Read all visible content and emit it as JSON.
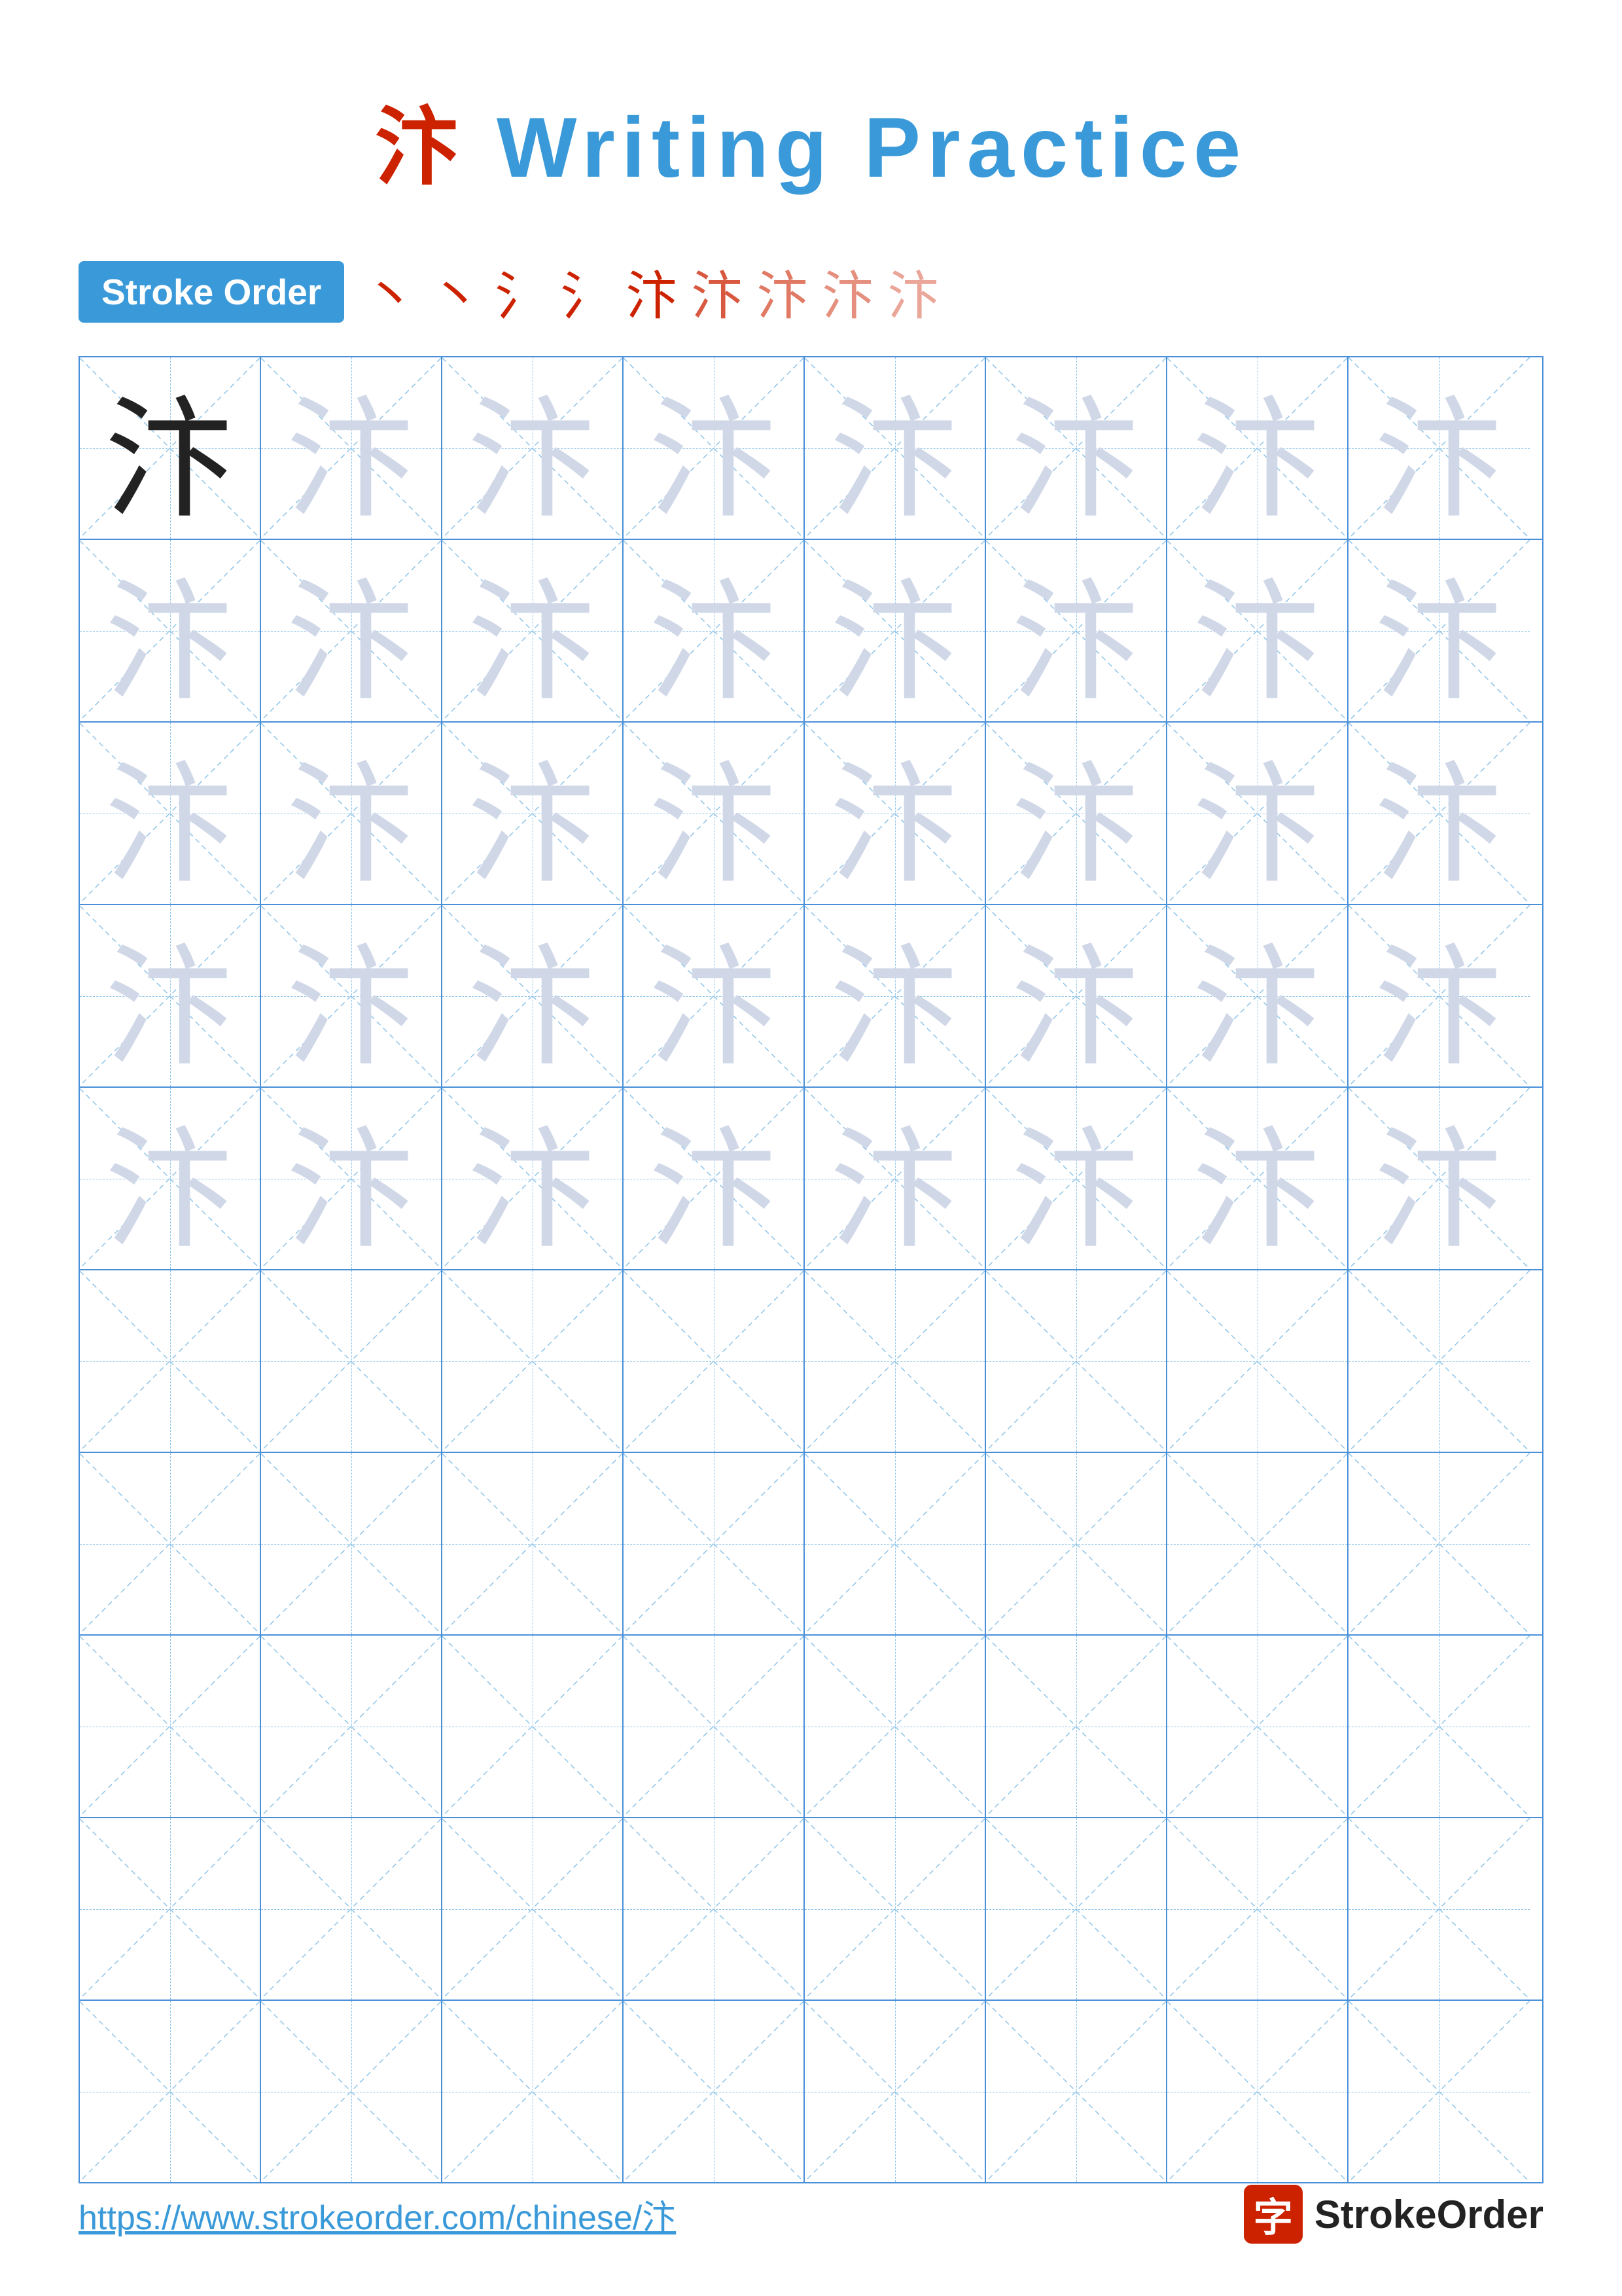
{
  "title": "汴 Writing Practice",
  "title_char": "汴",
  "title_suffix": " Writing Practice",
  "stroke_order": {
    "label": "Stroke Order",
    "chars": [
      "丶",
      "丶",
      "氵",
      "氵",
      "汴",
      "汴",
      "汴",
      "汴",
      "汴"
    ]
  },
  "practice_char": "汴",
  "rows": [
    {
      "type": "mixed",
      "cells": [
        "dark",
        "light",
        "light",
        "light",
        "light",
        "light",
        "light",
        "light"
      ]
    },
    {
      "type": "light",
      "cells": [
        "light",
        "light",
        "light",
        "light",
        "light",
        "light",
        "light",
        "light"
      ]
    },
    {
      "type": "light",
      "cells": [
        "light",
        "light",
        "light",
        "light",
        "light",
        "light",
        "light",
        "light"
      ]
    },
    {
      "type": "light",
      "cells": [
        "light",
        "light",
        "light",
        "light",
        "light",
        "light",
        "light",
        "light"
      ]
    },
    {
      "type": "light",
      "cells": [
        "light",
        "light",
        "light",
        "light",
        "light",
        "light",
        "light",
        "light"
      ]
    },
    {
      "type": "empty",
      "cells": [
        "empty",
        "empty",
        "empty",
        "empty",
        "empty",
        "empty",
        "empty",
        "empty"
      ]
    },
    {
      "type": "empty",
      "cells": [
        "empty",
        "empty",
        "empty",
        "empty",
        "empty",
        "empty",
        "empty",
        "empty"
      ]
    },
    {
      "type": "empty",
      "cells": [
        "empty",
        "empty",
        "empty",
        "empty",
        "empty",
        "empty",
        "empty",
        "empty"
      ]
    },
    {
      "type": "empty",
      "cells": [
        "empty",
        "empty",
        "empty",
        "empty",
        "empty",
        "empty",
        "empty",
        "empty"
      ]
    },
    {
      "type": "empty",
      "cells": [
        "empty",
        "empty",
        "empty",
        "empty",
        "empty",
        "empty",
        "empty",
        "empty"
      ]
    }
  ],
  "footer": {
    "url": "https://www.strokeorder.com/chinese/汴",
    "brand_name": "StrokeOrder",
    "brand_char": "字"
  }
}
